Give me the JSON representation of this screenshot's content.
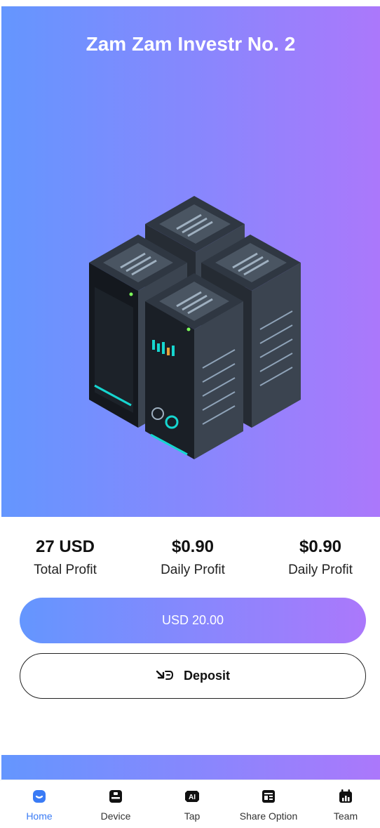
{
  "hero": {
    "title": "Zam Zam Investr No. 2",
    "image_icon": "server-rack-illustration"
  },
  "stats": [
    {
      "value": "27 USD",
      "label": "Total Profit"
    },
    {
      "value": "$0.90",
      "label": "Daily Profit"
    },
    {
      "value": "$0.90",
      "label": "Daily Profit"
    }
  ],
  "amount_button": {
    "label": "USD 20.00"
  },
  "deposit_button": {
    "label": "Deposit",
    "icon": "deposit-icon"
  },
  "tabbar": {
    "active": "home",
    "items": [
      {
        "label": "Home",
        "icon": "home-icon"
      },
      {
        "label": "Device",
        "icon": "device-icon"
      },
      {
        "label": "Tap",
        "icon": "ai-icon"
      },
      {
        "label": "Share Option",
        "icon": "share-card-icon"
      },
      {
        "label": "Team",
        "icon": "team-icon"
      }
    ]
  },
  "colors": {
    "gradient_start": "#6496fe",
    "gradient_end": "#ab78fb",
    "active_tab": "#3a7bf5",
    "server_body": "#3b4450",
    "screen_accent": "#16d6d0"
  }
}
